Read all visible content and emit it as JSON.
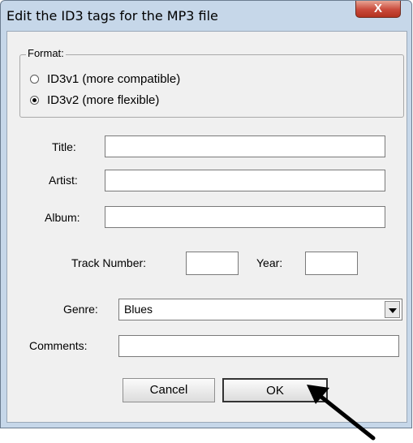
{
  "dialog": {
    "title": "Edit the ID3 tags for the MP3 file",
    "close_glyph": "X"
  },
  "format": {
    "label": "Format:",
    "options": [
      {
        "label": "ID3v1 (more compatible)",
        "selected": false
      },
      {
        "label": "ID3v2 (more flexible)",
        "selected": true
      }
    ]
  },
  "fields": {
    "title": {
      "label": "Title:",
      "value": ""
    },
    "artist": {
      "label": "Artist:",
      "value": ""
    },
    "album": {
      "label": "Album:",
      "value": ""
    },
    "track_number": {
      "label": "Track Number:",
      "value": ""
    },
    "year": {
      "label": "Year:",
      "value": ""
    },
    "genre": {
      "label": "Genre:",
      "value": "Blues"
    },
    "comments": {
      "label": "Comments:",
      "value": ""
    }
  },
  "buttons": {
    "cancel": "Cancel",
    "ok": "OK"
  },
  "colors": {
    "window_frame": "#c6d7e9",
    "dialog_face": "#f0f0f0",
    "close_button": "#c9493a"
  },
  "annotation": {
    "arrow_icon": "pointer-arrow"
  }
}
